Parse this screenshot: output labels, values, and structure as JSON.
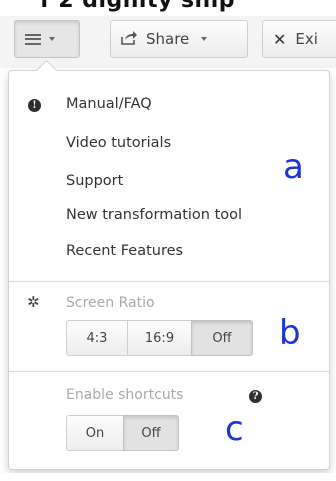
{
  "top_cut_text": "f  2  dignity  ship",
  "toolbar": {
    "share_label": "Share",
    "exit_label": "Exi"
  },
  "dropdown": {
    "help_items": [
      "Manual/FAQ",
      "Video tutorials",
      "Support",
      "New transformation tool",
      "Recent Features"
    ],
    "screen_ratio": {
      "label": "Screen Ratio",
      "options": [
        "4:3",
        "16:9",
        "Off"
      ],
      "selected": "Off"
    },
    "shortcuts": {
      "label": "Enable shortcuts",
      "options": [
        "On",
        "Off"
      ],
      "selected": "Off"
    }
  },
  "annotations": {
    "a": "a",
    "b": "b",
    "c": "c",
    "color": "#1a35d8"
  },
  "icons": {
    "menu": "hamburger-icon",
    "share": "share-icon",
    "exit": "close-icon",
    "help": "info-icon",
    "settings": "gear-icon"
  }
}
